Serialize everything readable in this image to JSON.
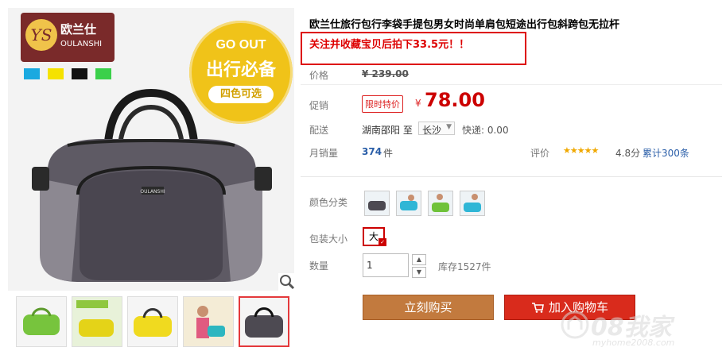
{
  "brand": {
    "logo_mark": "YS",
    "name_cn": "欧兰仕",
    "name_en": "OULANSHI"
  },
  "swatches": [
    "#1aa9e0",
    "#f5e200",
    "#111111",
    "#3bd04a"
  ],
  "badge": {
    "line1": "GO OUT",
    "line2": "出行必备",
    "line3": "四色可选"
  },
  "bag_logo_text": "OULANSHI",
  "product": {
    "title": "欧兰仕旅行包行李袋手提包男女时尚单肩包短途出行包斜跨包无拉杆",
    "promo": "关注并收藏宝贝后拍下33.5元！！"
  },
  "price": {
    "label": "价格",
    "original": "¥ 239.00"
  },
  "promotion": {
    "label": "促销",
    "tag": "限时特价",
    "yen": "¥",
    "price": "78.00"
  },
  "shipping": {
    "label": "配送",
    "from": "湖南邵阳 至",
    "to": "长沙",
    "fee": "快递: 0.00"
  },
  "sales": {
    "label": "月销量",
    "count": "374",
    "unit": "件"
  },
  "rating": {
    "label": "评价",
    "stars": "★★★★★",
    "score": "4.8分",
    "reviews": "累计300条"
  },
  "options": {
    "color_label": "颜色分类",
    "size_label": "包装大小",
    "size_value": "大",
    "qty_label": "数量",
    "qty_value": "1",
    "stock": "库存1527件"
  },
  "buttons": {
    "buy_now": "立刻购买",
    "add_cart": "加入购物车"
  },
  "watermark": {
    "big": "08我家",
    "small": "myhome2008.com"
  },
  "colors": {
    "price_red": "#c00",
    "buy_now": "#c27a3e",
    "add_cart": "#d92b1c",
    "link_blue": "#2a5ea8"
  },
  "thumbnails": [
    "thumb-green",
    "thumb-yellow-poster",
    "thumb-yellow",
    "thumb-model",
    "thumb-black"
  ]
}
